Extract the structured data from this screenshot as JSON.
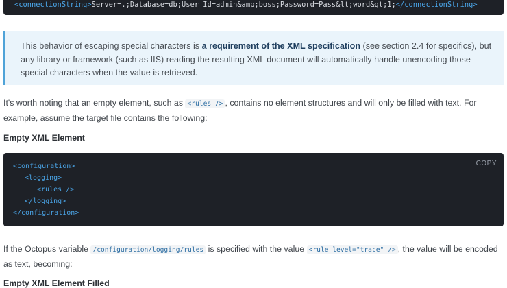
{
  "top_code": {
    "open_tag": "<connectionString>",
    "value": "Server=.;Database=db;User Id=admin&amp;boss;Password=Pass&lt;word&gt;1;",
    "close_tag": "</connectionString>"
  },
  "callout": {
    "before": "This behavior of escaping special characters is ",
    "link": "a requirement of the XML specification",
    "after": " (see section 2.4 for specifics), but any library or framework (such as IIS) reading the resulting XML document will automatically handle unencoding those special characters when the value is retrieved."
  },
  "para1": {
    "before": "It's worth noting that an empty element, such as ",
    "code": "<rules />",
    "after": ", contains no element structures and will only be filled with text. For example, assume the target file contains the following:"
  },
  "heading1": "Empty XML Element",
  "codeblock": {
    "copy_label": "COPY",
    "lines": [
      "<configuration>",
      "<logging>",
      "<rules />",
      "</logging>",
      "</configuration>"
    ]
  },
  "para2": {
    "before": "If the Octopus variable ",
    "code1": "/configuration/logging/rules",
    "middle": " is specified with the value ",
    "code2": "<rule level=\"trace\" />",
    "after": ", the value will be encoded as text, becoming:"
  },
  "heading2": "Empty XML Element Filled"
}
